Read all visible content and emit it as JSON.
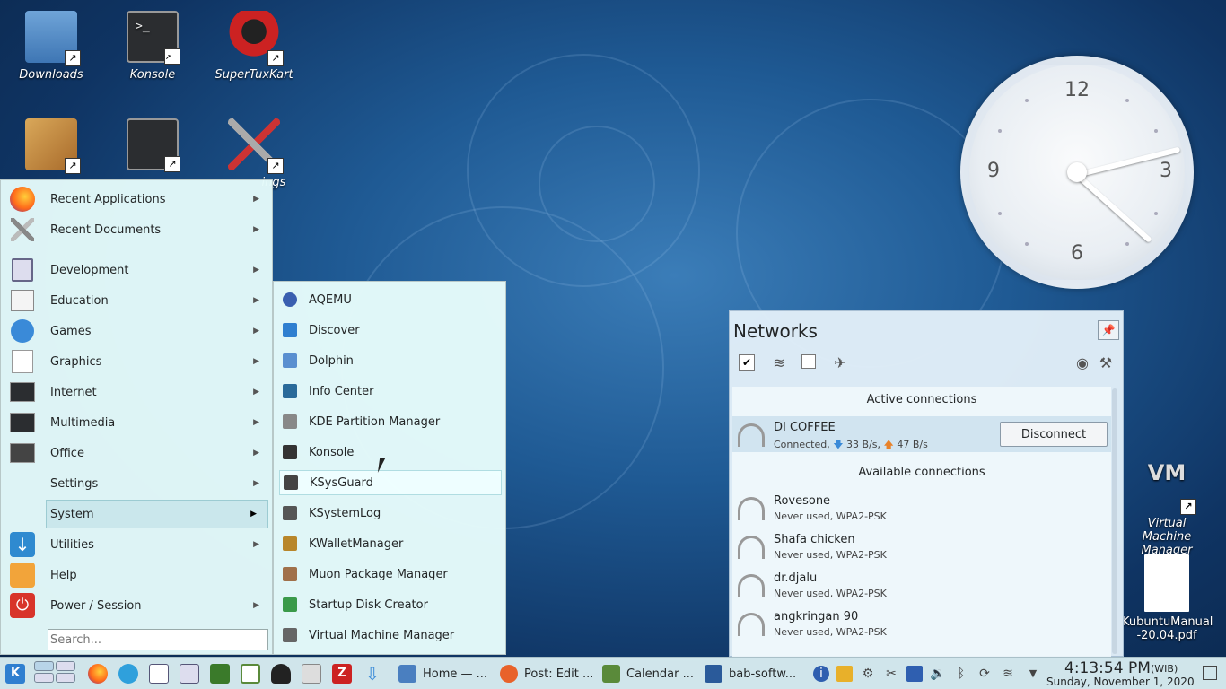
{
  "desktop": {
    "icons": [
      {
        "label": "Downloads"
      },
      {
        "label": "Konsole"
      },
      {
        "label": "SuperTuxKart"
      },
      {
        "label": ""
      },
      {
        "label": ""
      },
      {
        "label": "ings"
      },
      {
        "label": "Virtual Machine Manager"
      },
      {
        "label": "KubuntuManual -20.04.pdf"
      }
    ]
  },
  "clock": {
    "numbers": [
      "12",
      "3",
      "6",
      "9"
    ],
    "time": "4:13:54 PM"
  },
  "menu": {
    "items": [
      {
        "label": "Recent Applications"
      },
      {
        "label": "Recent Documents"
      },
      {
        "label": "Development"
      },
      {
        "label": "Education"
      },
      {
        "label": "Games"
      },
      {
        "label": "Graphics"
      },
      {
        "label": "Internet"
      },
      {
        "label": "Multimedia"
      },
      {
        "label": "Office"
      },
      {
        "label": "Settings"
      },
      {
        "label": "System"
      },
      {
        "label": "Utilities"
      },
      {
        "label": "Help"
      },
      {
        "label": "Power / Session"
      }
    ],
    "search_placeholder": "Search..."
  },
  "submenu": {
    "items": [
      {
        "label": "AQEMU",
        "color": "#3a5fb0"
      },
      {
        "label": "Discover",
        "color": "#2f7fd0"
      },
      {
        "label": "Dolphin",
        "color": "#5a8fd0"
      },
      {
        "label": "Info Center",
        "color": "#2a6a9a"
      },
      {
        "label": "KDE Partition Manager",
        "color": "#888"
      },
      {
        "label": "Konsole",
        "color": "#333"
      },
      {
        "label": "KSysGuard",
        "color": "#444"
      },
      {
        "label": "KSystemLog",
        "color": "#555"
      },
      {
        "label": "KWalletManager",
        "color": "#b8862a"
      },
      {
        "label": "Muon Package Manager",
        "color": "#a0704a"
      },
      {
        "label": "Startup Disk Creator",
        "color": "#3a9a4a"
      },
      {
        "label": "Virtual Machine Manager",
        "color": "#666"
      }
    ]
  },
  "networks": {
    "title": "Networks",
    "active_header": "Active connections",
    "available_header": "Available connections",
    "active": {
      "name": "DI COFFEE",
      "status": "Connected,",
      "down": "33 B/s,",
      "up": "47 B/s",
      "button": "Disconnect"
    },
    "available": [
      {
        "name": "Rovesone",
        "status": "Never used, WPA2-PSK"
      },
      {
        "name": "Shafa chicken",
        "status": "Never used, WPA2-PSK"
      },
      {
        "name": "dr.djalu",
        "status": "Never used, WPA2-PSK"
      },
      {
        "name": "angkringan 90",
        "status": "Never used, WPA2-PSK"
      }
    ]
  },
  "taskbar": {
    "tasks": [
      {
        "label": "Home — ...",
        "color": "#4a7fc0"
      },
      {
        "label": "Post: Edit ...",
        "color": "#e8622a"
      },
      {
        "label": "Calendar ...",
        "color": "#5a8a3a"
      },
      {
        "label": "bab-softw...",
        "color": "#2a5a9a"
      }
    ],
    "time": "4:13:54 PM",
    "timezone": "(WIB)",
    "date": "Sunday, November 1, 2020"
  }
}
